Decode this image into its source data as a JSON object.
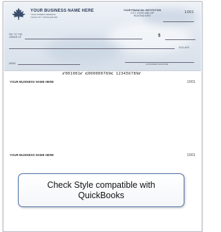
{
  "check": {
    "business_name": "YOUR BUSINESS NAME HERE",
    "address_line1": "YOUR STREET ADDRESS",
    "address_line2": "YOUR CITY, STATE AND ZIP",
    "bank_name": "YOUR FINANCIAL INSTITUTION",
    "bank_line2": "CITY, STATE AND ZIP",
    "bank_line3": "ROUTING INFO",
    "check_number": "1001",
    "pay_to_label": "PAY TO THE ORDER OF",
    "dollar_sign": "$",
    "dollars_label": "DOLLARS",
    "memo_label": "MEMO",
    "signature_label": "AUTHORIZED SIGNATURE",
    "micr": "⑈001001⑈ ⑆000000789⑆ 123456789⑈"
  },
  "stubs": [
    {
      "business_name": "YOUR BUSINESS NAME HERE",
      "check_number": "1001"
    },
    {
      "business_name": "YOUR BUSINESS NAME HERE",
      "check_number": "1001"
    }
  ],
  "callout": {
    "text": "Check Style compatible with QuickBooks"
  },
  "colors": {
    "check_bg": "#dfe6ef",
    "callout_border": "#4a6fa5"
  }
}
